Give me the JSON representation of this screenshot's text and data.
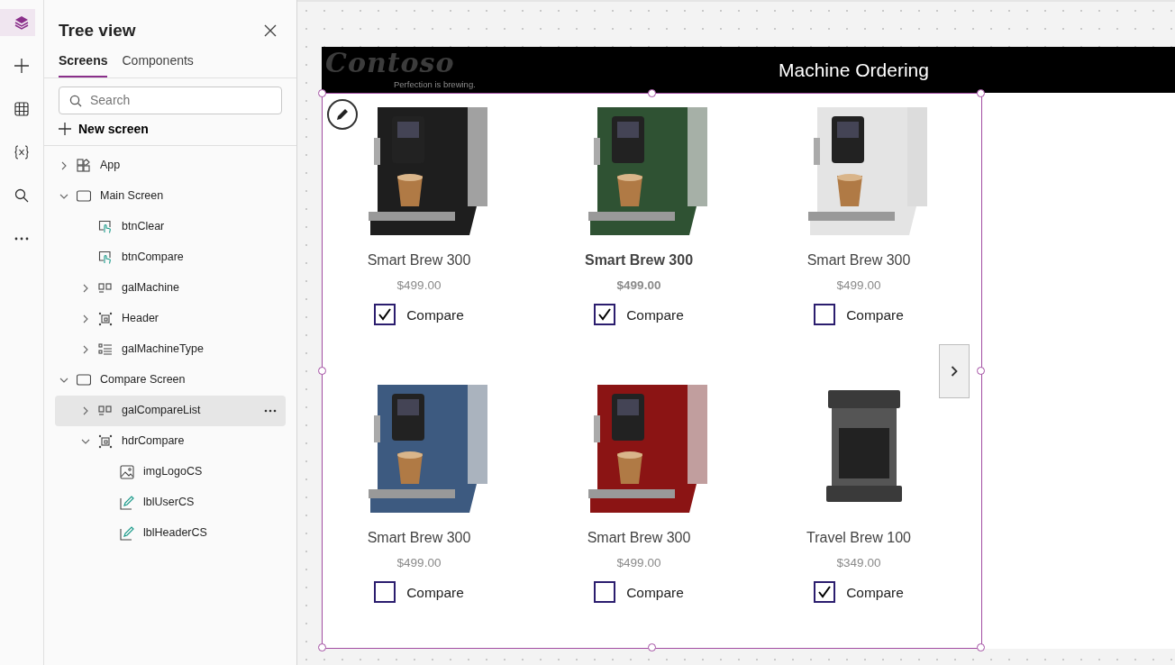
{
  "rail": [
    {
      "selected": true
    },
    {
      "selected": false
    },
    {
      "selected": false
    },
    {
      "selected": false
    },
    {
      "selected": false
    },
    {
      "selected": false
    }
  ],
  "panel": {
    "title": "Tree view",
    "tabs": [
      {
        "label": "Screens",
        "selected": true
      },
      {
        "label": "Components",
        "selected": false
      }
    ],
    "search": {
      "placeholder": "Search"
    },
    "new_screen": "New screen",
    "tree": [
      {
        "label": "App",
        "kind": "app",
        "expanded": false,
        "selected": false
      },
      {
        "label": "Main Screen",
        "kind": "screen",
        "expanded": true,
        "selected": false,
        "children": [
          {
            "label": "btnClear",
            "kind": "button",
            "selected": false
          },
          {
            "label": "btnCompare",
            "kind": "button",
            "selected": false
          },
          {
            "label": "galMachine",
            "kind": "gallery",
            "expanded": false,
            "selected": false
          },
          {
            "label": "Header",
            "kind": "group",
            "expanded": false,
            "selected": false
          },
          {
            "label": "galMachineType",
            "kind": "list",
            "expanded": false,
            "selected": false
          }
        ]
      },
      {
        "label": "Compare Screen",
        "kind": "screen",
        "expanded": true,
        "selected": false,
        "children": [
          {
            "label": "galCompareList",
            "kind": "gallery",
            "expanded": false,
            "selected": true
          },
          {
            "label": "hdrCompare",
            "kind": "group",
            "expanded": true,
            "selected": false,
            "children": [
              {
                "label": "imgLogoCS",
                "kind": "image",
                "selected": false
              },
              {
                "label": "lblUserCS",
                "kind": "label",
                "selected": false
              },
              {
                "label": "lblHeaderCS",
                "kind": "label",
                "selected": false
              }
            ]
          }
        ]
      }
    ]
  },
  "screen": {
    "logo": "Contoso",
    "tagline": "Perfection is brewing.",
    "title": "Machine Ordering",
    "items": [
      {
        "name": "Smart Brew 300",
        "price": "$499.00",
        "compare_label": "Compare",
        "checked": true,
        "selected": false,
        "kind": "espresso",
        "color": "#1e1e1e"
      },
      {
        "name": "Smart Brew 300",
        "price": "$499.00",
        "compare_label": "Compare",
        "checked": true,
        "selected": true,
        "kind": "espresso",
        "color": "#2f5233"
      },
      {
        "name": "Smart Brew 300",
        "price": "$499.00",
        "compare_label": "Compare",
        "checked": false,
        "selected": false,
        "kind": "espresso",
        "color": "#e4e4e4"
      },
      {
        "name": "Smart Brew 300",
        "price": "$499.00",
        "compare_label": "Compare",
        "checked": false,
        "selected": false,
        "kind": "espresso",
        "color": "#3d5a80"
      },
      {
        "name": "Smart Brew 300",
        "price": "$499.00",
        "compare_label": "Compare",
        "checked": false,
        "selected": false,
        "kind": "espresso",
        "color": "#8b1414"
      },
      {
        "name": "Travel Brew 100",
        "price": "$349.00",
        "compare_label": "Compare",
        "checked": true,
        "selected": false,
        "kind": "drip",
        "color": "#3a3a3a"
      }
    ]
  }
}
